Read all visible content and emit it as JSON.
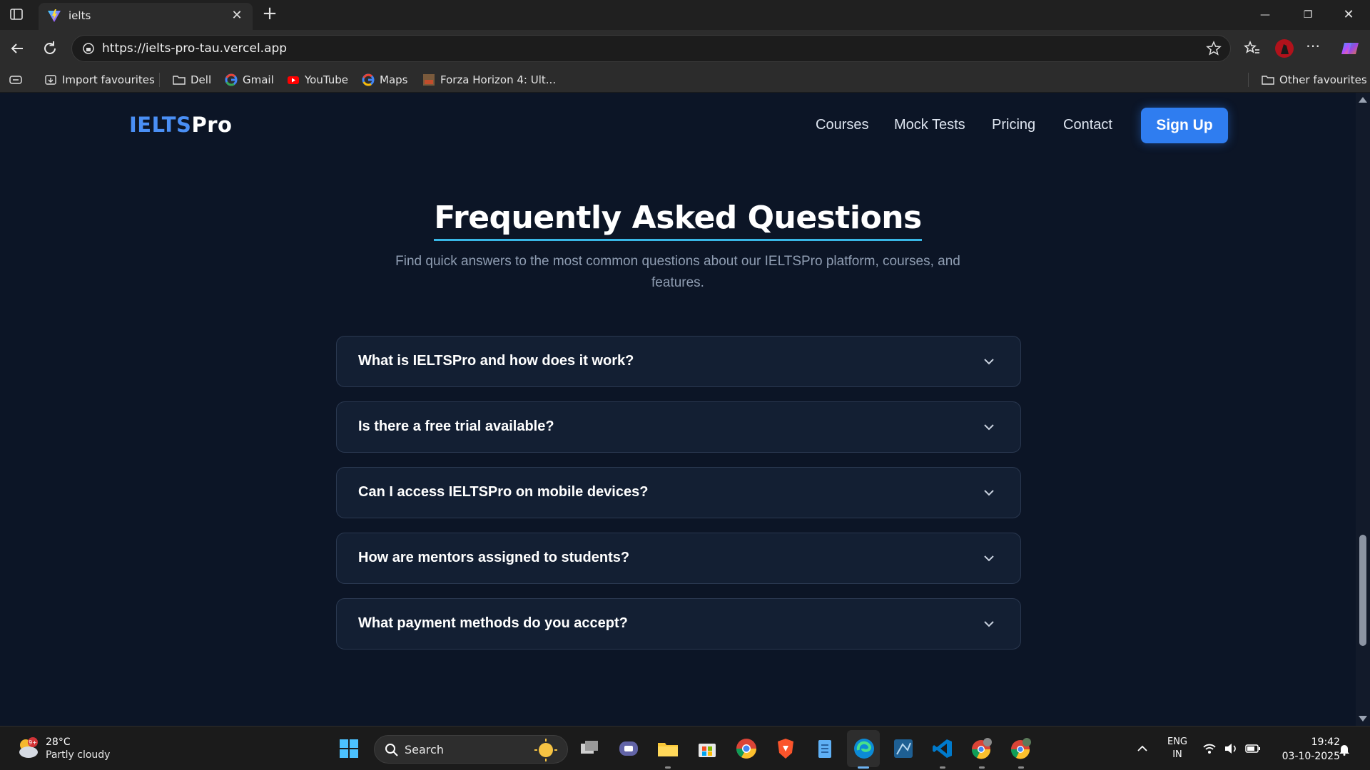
{
  "browser": {
    "tab_title": "ielts",
    "url": "https://ielts-pro-tau.vercel.app",
    "bookmarks": [
      {
        "label": "Import favourites"
      },
      {
        "label": "Dell"
      },
      {
        "label": "Gmail"
      },
      {
        "label": "YouTube"
      },
      {
        "label": "Maps"
      },
      {
        "label": "Forza Horizon 4: Ult..."
      }
    ],
    "other_favourites": "Other favourites"
  },
  "site": {
    "logo_part1": "IELTS",
    "logo_part2": "Pro",
    "nav": [
      "Courses",
      "Mock Tests",
      "Pricing",
      "Contact"
    ],
    "signup_label": "Sign Up"
  },
  "faq": {
    "title": "Frequently Asked Questions",
    "subtitle": "Find quick answers to the most common questions about our IELTSPro platform, courses, and features.",
    "items": [
      {
        "question": "What is IELTSPro and how does it work?"
      },
      {
        "question": "Is there a free trial available?"
      },
      {
        "question": "Can I access IELTSPro on mobile devices?"
      },
      {
        "question": "How are mentors assigned to students?"
      },
      {
        "question": "What payment methods do you accept?"
      }
    ]
  },
  "taskbar": {
    "weather_temp": "28°C",
    "weather_desc": "Partly cloudy",
    "weather_badge": "9+",
    "search_label": "Search",
    "lang_top": "ENG",
    "lang_bottom": "IN",
    "time": "19:42",
    "date": "03-10-2025"
  },
  "colors": {
    "accent": "#2f7df0",
    "logo_blue": "#4a8ff5",
    "title_underline": "#39b7e6",
    "page_bg": "#0c1526",
    "card_bg": "#131f33"
  }
}
